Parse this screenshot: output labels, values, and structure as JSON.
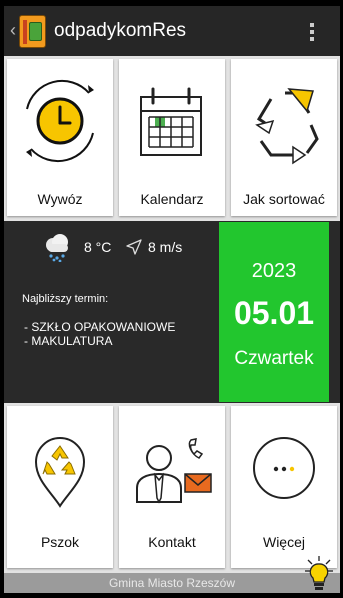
{
  "app_bar": {
    "back_glyph": "‹",
    "title": "odpadykomRes",
    "logo_icon": "app-logo-bins-icon",
    "menu_icon": "overflow-menu-icon"
  },
  "tiles_top": [
    {
      "label": "Wywóz",
      "icon": "clock-icon"
    },
    {
      "label": "Kalendarz",
      "icon": "calendar-icon"
    },
    {
      "label": "Jak sortować",
      "icon": "recycle-icon"
    }
  ],
  "info": {
    "temperature": "8 °C",
    "wind": "8 m/s",
    "next_term_label": "Najbliższy termin:",
    "waste_types": [
      "- SZKŁO OPAKOWANIOWE",
      "- MAKULATURA"
    ],
    "date": {
      "year": "2023",
      "day_month": "05.01",
      "weekday": "Czwartek"
    },
    "accent_color": "#22c62e"
  },
  "tiles_bottom": [
    {
      "label": "Pszok",
      "icon": "recycle-pin-icon"
    },
    {
      "label": "Kontakt",
      "icon": "contact-person-icon"
    },
    {
      "label": "Więcej",
      "icon": "more-dots-icon"
    }
  ],
  "footer": {
    "text": "Gmina Miasto Rzeszów",
    "icon": "lightbulb-icon"
  }
}
